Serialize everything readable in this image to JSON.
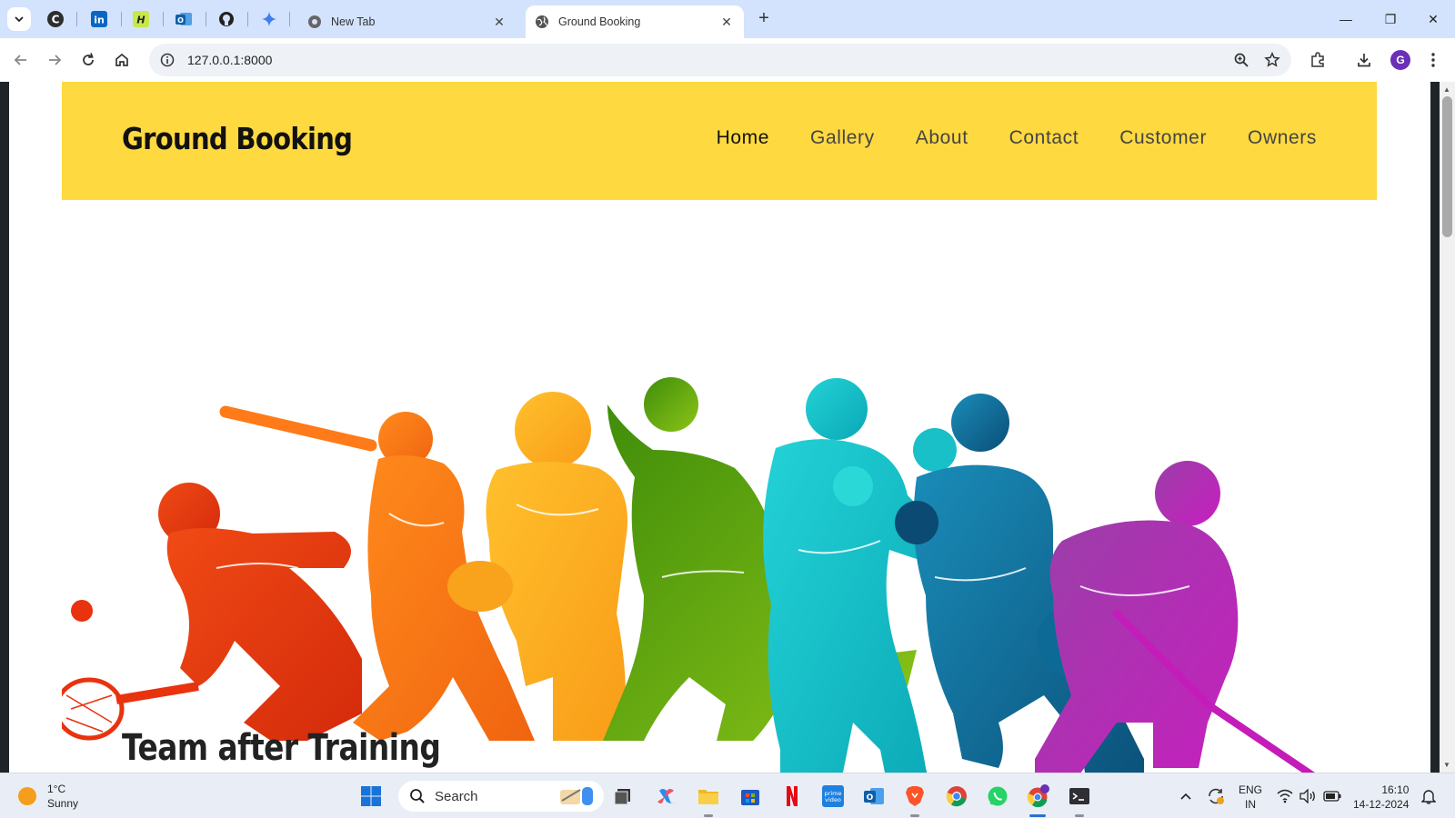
{
  "browser": {
    "pinned_tabs": [
      "copilot-c-icon",
      "linkedin-icon",
      "hashnode-icon",
      "outlook-icon",
      "github-icon",
      "gemini-icon"
    ],
    "tabs": [
      {
        "title": "New Tab",
        "close": "✕"
      },
      {
        "title": "Ground Booking",
        "close": "✕"
      }
    ],
    "new_tab": "+",
    "window_controls": {
      "minimize": "—",
      "restore": "❐",
      "close": "✕"
    },
    "url": "127.0.0.1:8000",
    "profile_initial": "G"
  },
  "site": {
    "brand": "Ground Booking",
    "nav": [
      {
        "label": "Home",
        "active": true
      },
      {
        "label": "Gallery",
        "active": false
      },
      {
        "label": "About",
        "active": false
      },
      {
        "label": "Contact",
        "active": false
      },
      {
        "label": "Customer",
        "active": false
      },
      {
        "label": "Owners",
        "active": false
      }
    ],
    "section_heading": "Team after Training",
    "colors": {
      "header_bg": "#fed940",
      "nav_text": "#444444",
      "brand_text": "#111111"
    }
  },
  "taskbar": {
    "weather_temp": "1°C",
    "weather_desc": "Sunny",
    "search_label": "Search",
    "apps": [
      "windows-start-icon",
      "task-view-icon",
      "copilot-icon",
      "file-explorer-icon",
      "microsoft-store-icon",
      "netflix-icon",
      "prime-video-icon",
      "outlook-icon",
      "brave-icon",
      "chrome-icon",
      "whatsapp-icon",
      "chrome-profile-icon",
      "terminal-icon"
    ],
    "lang_line1": "ENG",
    "lang_line2": "IN",
    "time": "16:10",
    "date": "14-12-2024"
  }
}
